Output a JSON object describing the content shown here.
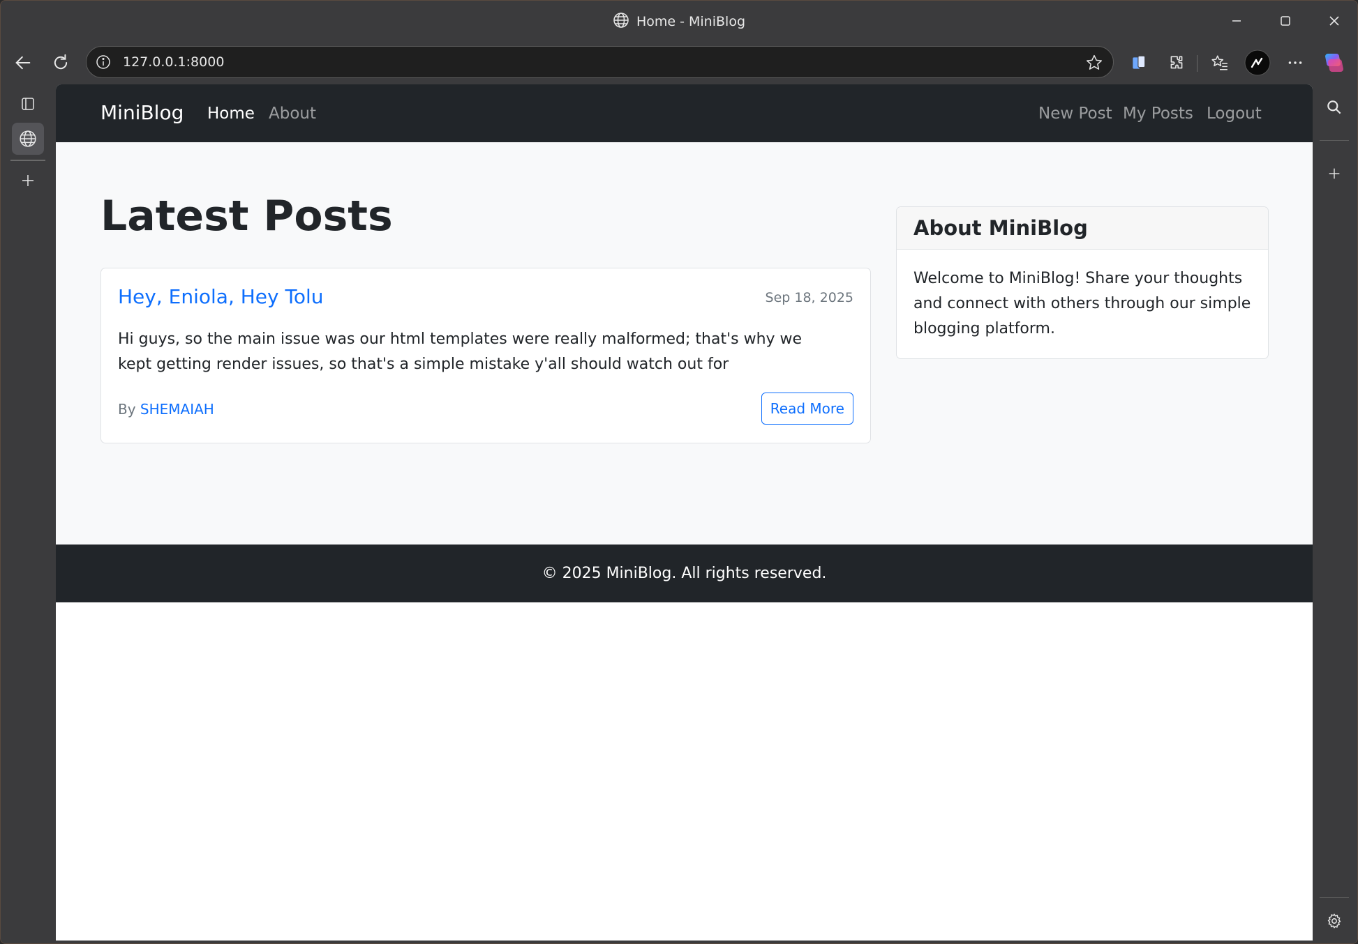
{
  "window": {
    "title": "Home - MiniBlog"
  },
  "browser": {
    "url": "127.0.0.1:8000"
  },
  "site": {
    "brand": "MiniBlog",
    "nav_left": [
      {
        "label": "Home",
        "active": true
      },
      {
        "label": "About",
        "active": false
      }
    ],
    "nav_right": [
      {
        "label": "New Post"
      },
      {
        "label": "My Posts"
      },
      {
        "label": "Logout"
      }
    ]
  },
  "main": {
    "heading": "Latest Posts",
    "posts": [
      {
        "title": "Hey, Eniola, Hey Tolu",
        "date": "Sep 18, 2025",
        "excerpt": "Hi guys, so the main issue was our html templates were really malformed; that's why we kept getting render issues, so that's a simple mistake y'all should watch out for",
        "author_prefix": "By",
        "author": "SHEMAIAH",
        "read_more": "Read More"
      }
    ]
  },
  "sidebar": {
    "title": "About MiniBlog",
    "body": "Welcome to MiniBlog! Share your thoughts and connect with others through our simple blogging platform."
  },
  "footer": {
    "text": "© 2025 MiniBlog. All rights reserved."
  },
  "colors": {
    "primary": "#0d6efd",
    "navbar": "#212529",
    "page_bg": "#f8f9fa"
  }
}
